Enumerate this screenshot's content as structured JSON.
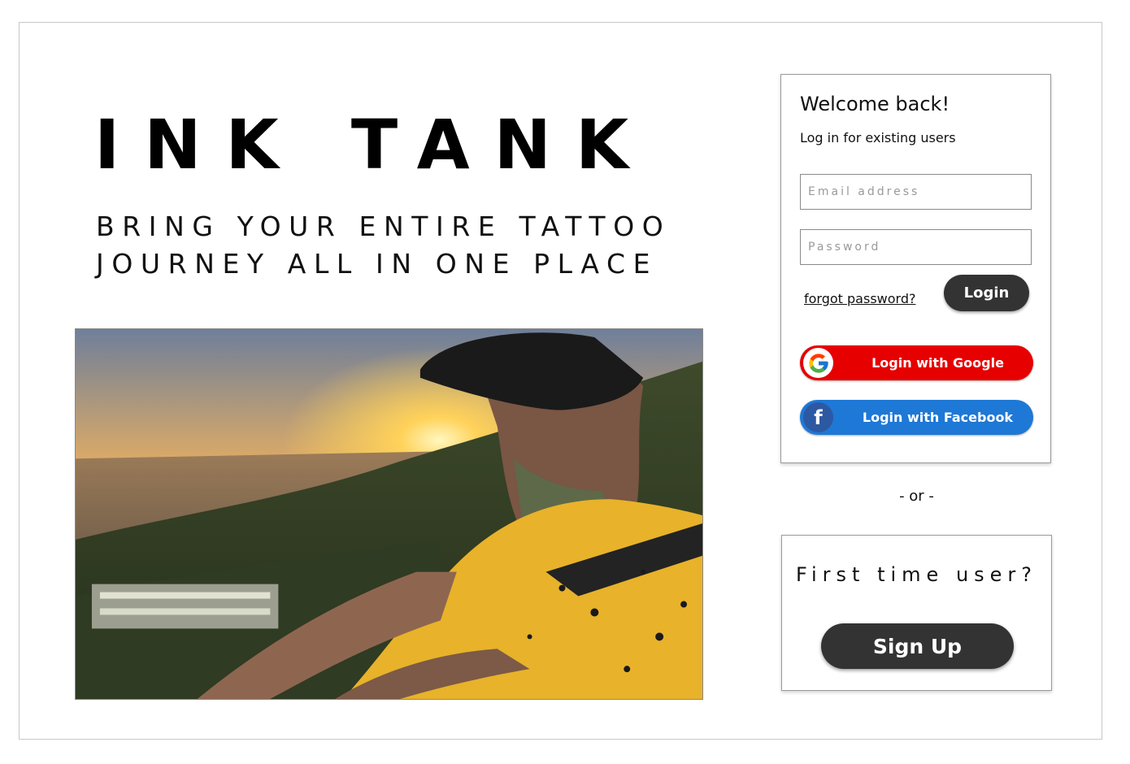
{
  "brand": {
    "title": "INK TANK",
    "tagline_line1": "BRING YOUR ENTIRE TATTOO",
    "tagline_line2": "JOURNEY ALL IN ONE PLACE"
  },
  "login": {
    "heading": "Welcome back!",
    "subtitle": "Log in for existing users",
    "email_placeholder": "Email address",
    "password_placeholder": "Password",
    "forgot_label": "forgot password?",
    "login_label": "Login",
    "google_label": "Login with Google",
    "facebook_label": "Login with Facebook",
    "facebook_glyph": "f"
  },
  "separator": "- or -",
  "signup": {
    "prompt": "First time user?",
    "button_label": "Sign Up"
  },
  "colors": {
    "dark_button": "#333333",
    "google_red": "#e60000",
    "facebook_blue": "#1e78d6"
  },
  "icons": {
    "google": "google-logo-icon",
    "facebook": "facebook-logo-icon"
  }
}
